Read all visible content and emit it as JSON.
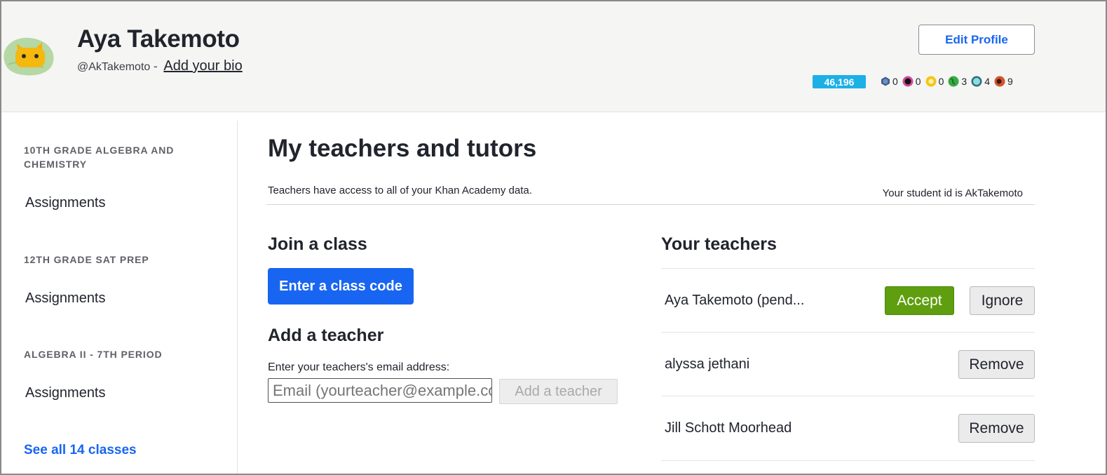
{
  "profile": {
    "name": "Aya Takemoto",
    "handle": "@AkTakemoto",
    "separator": " - ",
    "bio_link": "Add your bio",
    "edit_button": "Edit Profile",
    "points": "46,196",
    "badges": [
      {
        "icon": "hex-badge-icon",
        "count": "0",
        "color": "#3a5a8c"
      },
      {
        "icon": "black-hole-badge-icon",
        "count": "0",
        "color": "#d24a9e"
      },
      {
        "icon": "sun-badge-icon",
        "count": "0",
        "color": "#f5c518"
      },
      {
        "icon": "earth-badge-icon",
        "count": "3",
        "color": "#39a845"
      },
      {
        "icon": "moon-badge-icon",
        "count": "4",
        "color": "#4fb8c2"
      },
      {
        "icon": "meteorite-badge-icon",
        "count": "9",
        "color": "#d4532d"
      }
    ]
  },
  "sidebar": {
    "classes": [
      {
        "title": "10TH GRADE ALGEBRA AND CHEMISTRY",
        "link": "Assignments"
      },
      {
        "title": "12TH GRADE SAT PREP",
        "link": "Assignments"
      },
      {
        "title": "ALGEBRA II - 7TH PERIOD",
        "link": "Assignments"
      }
    ],
    "see_all": "See all 14 classes"
  },
  "main": {
    "title": "My teachers and tutors",
    "access_note": "Teachers have access to all of your Khan Academy data.",
    "student_id": "Your student id is AkTakemoto",
    "join": {
      "heading": "Join a class",
      "button": "Enter a class code"
    },
    "add_teacher": {
      "heading": "Add a teacher",
      "label": "Enter your teachers's email address:",
      "placeholder": "Email (yourteacher@example.com)",
      "button": "Add a teacher"
    },
    "teachers": {
      "heading": "Your teachers",
      "rows": [
        {
          "name": "Aya Takemoto (pend...",
          "accept": "Accept",
          "ignore": "Ignore"
        },
        {
          "name": "alyssa jethani",
          "remove": "Remove"
        },
        {
          "name": "Jill Schott Moorhead",
          "remove": "Remove"
        }
      ]
    }
  },
  "colors": {
    "brand_blue": "#1865f2",
    "accept_green": "#5e9e0f",
    "points_cyan": "#1cb0e7"
  }
}
